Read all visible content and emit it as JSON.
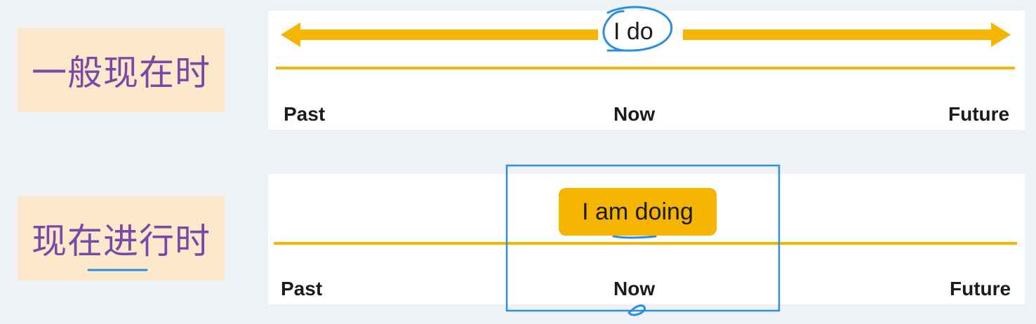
{
  "colors": {
    "background": "#eef1f6",
    "label_bg": "#fce8cb",
    "label_text": "#7b48a6",
    "timeline": "#f5b400",
    "annotation": "#2a8fe0"
  },
  "tenses": [
    {
      "label": "一般现在时",
      "example": "I do",
      "timeline": {
        "past": "Past",
        "now": "Now",
        "future": "Future"
      }
    },
    {
      "label": "现在进行时",
      "example": "I am doing",
      "timeline": {
        "past": "Past",
        "now": "Now",
        "future": "Future"
      }
    }
  ]
}
